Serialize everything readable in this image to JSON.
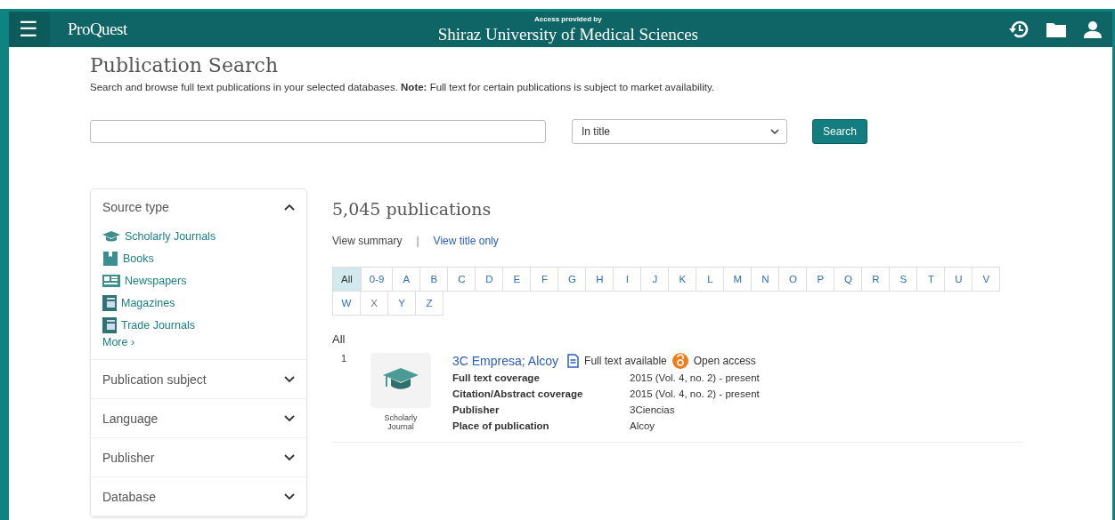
{
  "header": {
    "menu_icon": "☰",
    "brand": "ProQuest",
    "access_label": "Access provided by",
    "institution": "Shiraz University of Medical Sciences"
  },
  "page": {
    "title": "Publication Search",
    "intro": "Search and browse full text publications in your selected databases. **Note:** Full text for certain publications is subject to market availability."
  },
  "search": {
    "scope": "In title",
    "button": "Search"
  },
  "filters": [
    {
      "label": "Source type",
      "expanded": true,
      "items": [
        {
          "kind": "journal",
          "label": "Scholarly Journals"
        },
        {
          "kind": "book",
          "label": "Books"
        },
        {
          "kind": "newspaper",
          "label": "Newspapers"
        },
        {
          "kind": "magazine",
          "label": "Magazines"
        },
        {
          "kind": "magazine",
          "label": "Trade Journals"
        }
      ],
      "more": "More ›"
    },
    {
      "label": "Publication subject",
      "expanded": false
    },
    {
      "label": "Language",
      "expanded": false
    },
    {
      "label": "Publisher",
      "expanded": false
    },
    {
      "label": "Database",
      "expanded": false
    }
  ],
  "results": {
    "count": "5,045 publications",
    "views": [
      {
        "label": "View summary",
        "selected": true
      },
      {
        "label": "View title only",
        "selected": false
      }
    ],
    "separator": "|",
    "letters": [
      {
        "label": "All",
        "selected": true,
        "disabled": false
      },
      {
        "label": "0-9",
        "selected": false,
        "disabled": false
      },
      {
        "label": "A",
        "selected": false,
        "disabled": false
      },
      {
        "label": "B",
        "selected": false,
        "disabled": false
      },
      {
        "label": "C",
        "selected": false,
        "disabled": false
      },
      {
        "label": "D",
        "selected": false,
        "disabled": false
      },
      {
        "label": "E",
        "selected": false,
        "disabled": false
      },
      {
        "label": "F",
        "selected": false,
        "disabled": false
      },
      {
        "label": "G",
        "selected": false,
        "disabled": false
      },
      {
        "label": "H",
        "selected": false,
        "disabled": false
      },
      {
        "label": "I",
        "selected": false,
        "disabled": false
      },
      {
        "label": "J",
        "selected": false,
        "disabled": false
      },
      {
        "label": "K",
        "selected": false,
        "disabled": false
      },
      {
        "label": "L",
        "selected": false,
        "disabled": false
      },
      {
        "label": "M",
        "selected": false,
        "disabled": false
      },
      {
        "label": "N",
        "selected": false,
        "disabled": false
      },
      {
        "label": "O",
        "selected": false,
        "disabled": false
      },
      {
        "label": "P",
        "selected": false,
        "disabled": false
      },
      {
        "label": "Q",
        "selected": false,
        "disabled": false
      },
      {
        "label": "R",
        "selected": false,
        "disabled": false
      },
      {
        "label": "S",
        "selected": false,
        "disabled": false
      },
      {
        "label": "T",
        "selected": false,
        "disabled": false
      },
      {
        "label": "U",
        "selected": false,
        "disabled": false
      },
      {
        "label": "V",
        "selected": false,
        "disabled": false
      },
      {
        "label": "W",
        "selected": false,
        "disabled": false
      },
      {
        "label": "X",
        "selected": false,
        "disabled": true
      },
      {
        "label": "Y",
        "selected": false,
        "disabled": false
      },
      {
        "label": "Z",
        "selected": false,
        "disabled": false
      }
    ],
    "group_heading": "All",
    "items": [
      {
        "number": "1",
        "type_label": "Scholarly Journal",
        "title": "3C Empresa; Alcoy",
        "full_text": "Full text available",
        "open_access": "Open access",
        "details": [
          {
            "label": "Full text coverage",
            "value": "2015 (Vol. 4, no. 2) - present"
          },
          {
            "label": "Citation/Abstract coverage",
            "value": "2015 (Vol. 4, no. 2) - present"
          },
          {
            "label": "Publisher",
            "value": "3Ciencias"
          },
          {
            "label": "Place of publication",
            "value": "Alcoy"
          }
        ]
      }
    ]
  }
}
